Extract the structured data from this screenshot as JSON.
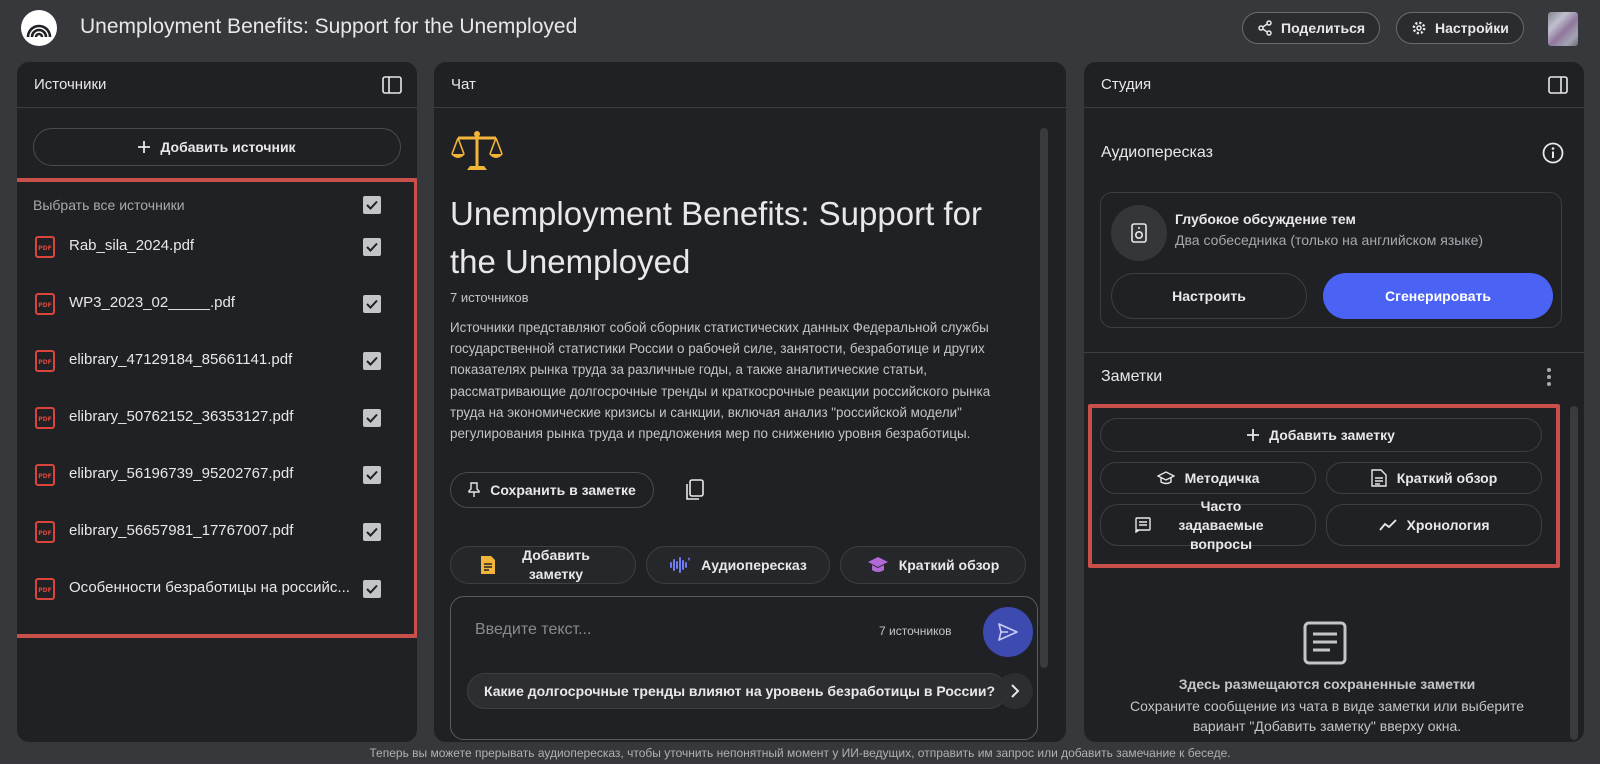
{
  "header": {
    "title": "Unemployment Benefits: Support for the Unemployed",
    "share_label": "Поделиться",
    "settings_label": "Настройки"
  },
  "sources": {
    "panel_title": "Источники",
    "add_source_label": "Добавить источник",
    "select_all_label": "Выбрать все источники",
    "items": [
      {
        "name": "Rab_sila_2024.pdf",
        "checked": true
      },
      {
        "name": "WP3_2023_02_____.pdf",
        "checked": true
      },
      {
        "name": "elibrary_47129184_85661141.pdf",
        "checked": true
      },
      {
        "name": "elibrary_50762152_36353127.pdf",
        "checked": true
      },
      {
        "name": "elibrary_56196739_95202767.pdf",
        "checked": true
      },
      {
        "name": "elibrary_56657981_17767007.pdf",
        "checked": true
      },
      {
        "name": "Особенности безработицы на российс...",
        "checked": true
      }
    ]
  },
  "chat": {
    "panel_title": "Чат",
    "notebook_title": "Unemployment Benefits: Support for the Unemployed",
    "source_count": "7 источников",
    "summary": "Источники представляют собой сборник статистических данных Федеральной службы государственной статистики России о рабочей силе, занятости, безработице и других показателях рынка труда за различные годы, а также аналитические статьи, рассматривающие долгосрочные тренды и краткосрочные реакции российского рынка труда на экономические кризисы и санкции, включая анализ \"российской модели\" регулирования рынка труда и предложения мер по снижению уровня безработицы.",
    "save_to_note_label": "Сохранить в заметке",
    "chips": {
      "add_note": "Добавить заметку",
      "audio": "Аудиопересказ",
      "brief": "Краткий обзор"
    },
    "input": {
      "placeholder": "Введите текст...",
      "source_count": "7 источников"
    },
    "suggestion": "Какие долгосрочные тренды влияют на уровень безработицы в России?"
  },
  "studio": {
    "panel_title": "Студия",
    "audio_section_title": "Аудиопересказ",
    "audio_card": {
      "title": "Глубокое обсуждение тем",
      "subtitle": "Два собеседника (только на английском языке)",
      "customize_label": "Настроить",
      "generate_label": "Сгенерировать"
    },
    "notes_title": "Заметки",
    "note_actions": {
      "add_note": "Добавить заметку",
      "study_guide": "Методичка",
      "brief": "Краткий обзор",
      "faq": "Часто задаваемые вопросы",
      "timeline": "Хронология"
    },
    "empty_state": {
      "title": "Здесь размещаются сохраненные заметки",
      "subtitle": "Сохраните сообщение из чата в виде заметки или выберите вариант \"Добавить заметку\" вверху окна."
    }
  },
  "footer": {
    "text": "Теперь вы можете прерывать аудиопересказ, чтобы уточнить непонятный момент у ИИ-ведущих, отправить им запрос или добавить замечание к беседе."
  },
  "colors": {
    "background": "#37383b",
    "panel": "#202124",
    "accent_blue": "#4a63f5",
    "highlight_red": "#c9504a",
    "pdf_red": "#d9453b",
    "scales_gold": "#f2b53a"
  },
  "icons": [
    "notebook-logo-icon",
    "share-icon",
    "gear-icon",
    "panel-toggle-icon",
    "plus-icon",
    "checkbox-icon",
    "pdf-icon",
    "scales-icon",
    "pin-icon",
    "copy-icon",
    "note-icon",
    "waveform-icon",
    "graduation-cap-icon",
    "send-icon",
    "chevron-right-icon",
    "info-icon",
    "speaker-icon",
    "kebab-icon",
    "faq-icon",
    "timeline-icon",
    "empty-notes-icon"
  ]
}
